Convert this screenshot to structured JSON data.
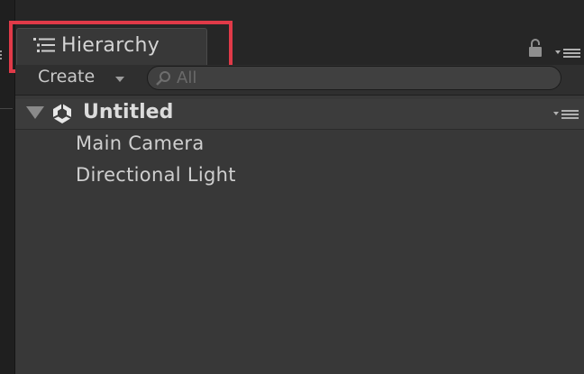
{
  "hierarchy": {
    "tab_label": "Hierarchy",
    "create_label": "Create",
    "search_placeholder": "All",
    "scene_name": "Untitled",
    "objects": [
      "Main Camera",
      "Directional Light"
    ]
  },
  "icons": {
    "tab": "hierarchy-list-icon",
    "lock": "lock-icon",
    "menu": "context-menu-icon",
    "scene": "unity-logo-icon",
    "search": "search-icon"
  },
  "colors": {
    "highlight": "#e03a48",
    "panel_bg": "#383838",
    "text": "#cfcfcf"
  }
}
